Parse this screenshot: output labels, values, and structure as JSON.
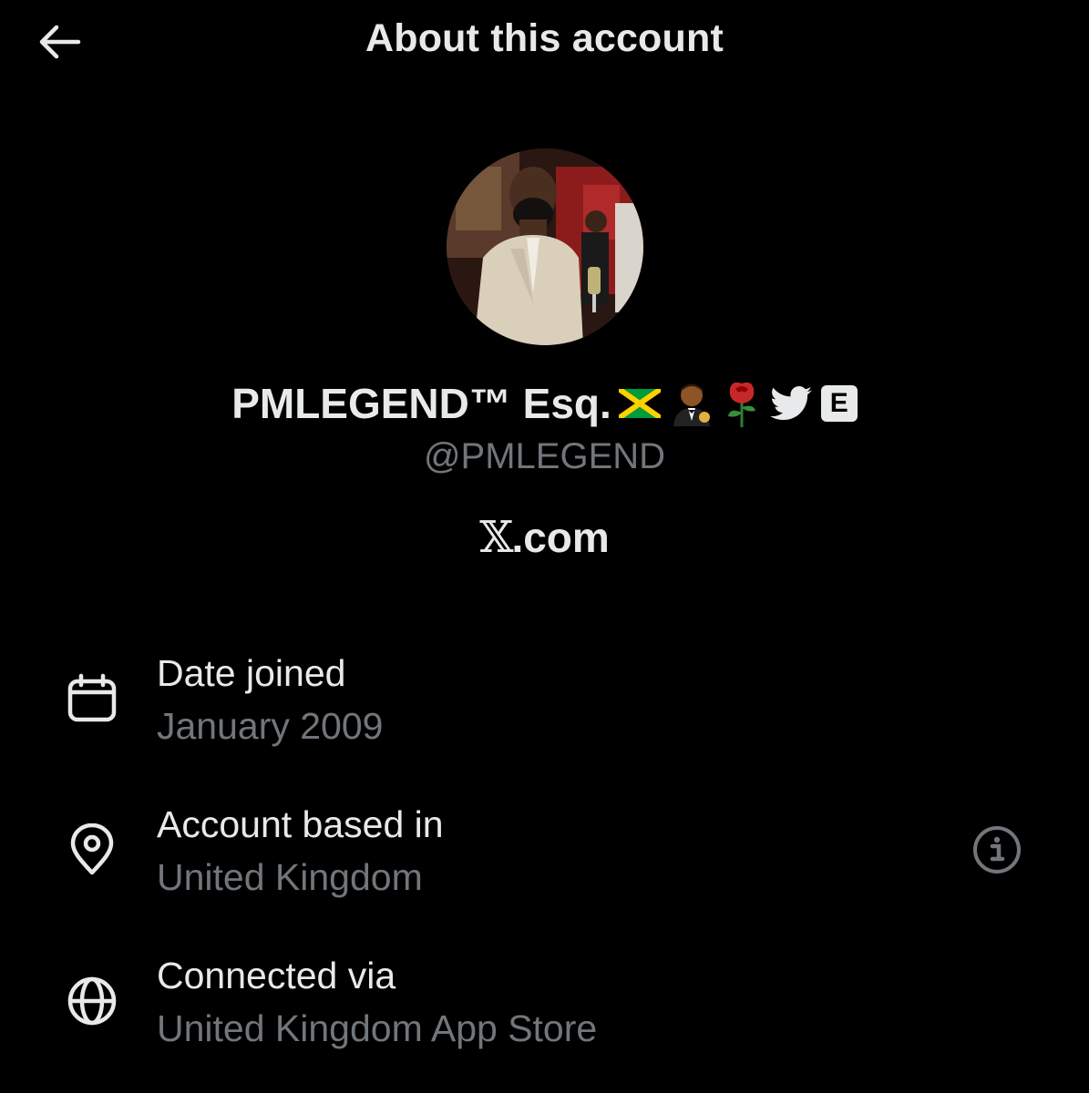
{
  "header": {
    "title": "About this account",
    "back_icon": "arrow-left-icon"
  },
  "profile": {
    "display_name": "PMLEGEND™ Esq.",
    "name_emojis": [
      "🇯🇲",
      "🤵🏾",
      "🌹"
    ],
    "bird_icon": "twitter-bird-icon",
    "e_badge": "E",
    "handle": "@PMLEGEND",
    "platform_mark": "𝕏",
    "platform_suffix": ".com"
  },
  "details": [
    {
      "icon": "calendar-icon",
      "label": "Date joined",
      "value": "January 2009"
    },
    {
      "icon": "location-pin-icon",
      "label": "Account based in",
      "value": "United Kingdom",
      "info_icon": "info-icon"
    },
    {
      "icon": "globe-icon",
      "label": "Connected via",
      "value": "United Kingdom App Store"
    }
  ],
  "colors": {
    "background": "#000000",
    "primary_text": "#e7e9ea",
    "secondary_text": "#71767b"
  }
}
